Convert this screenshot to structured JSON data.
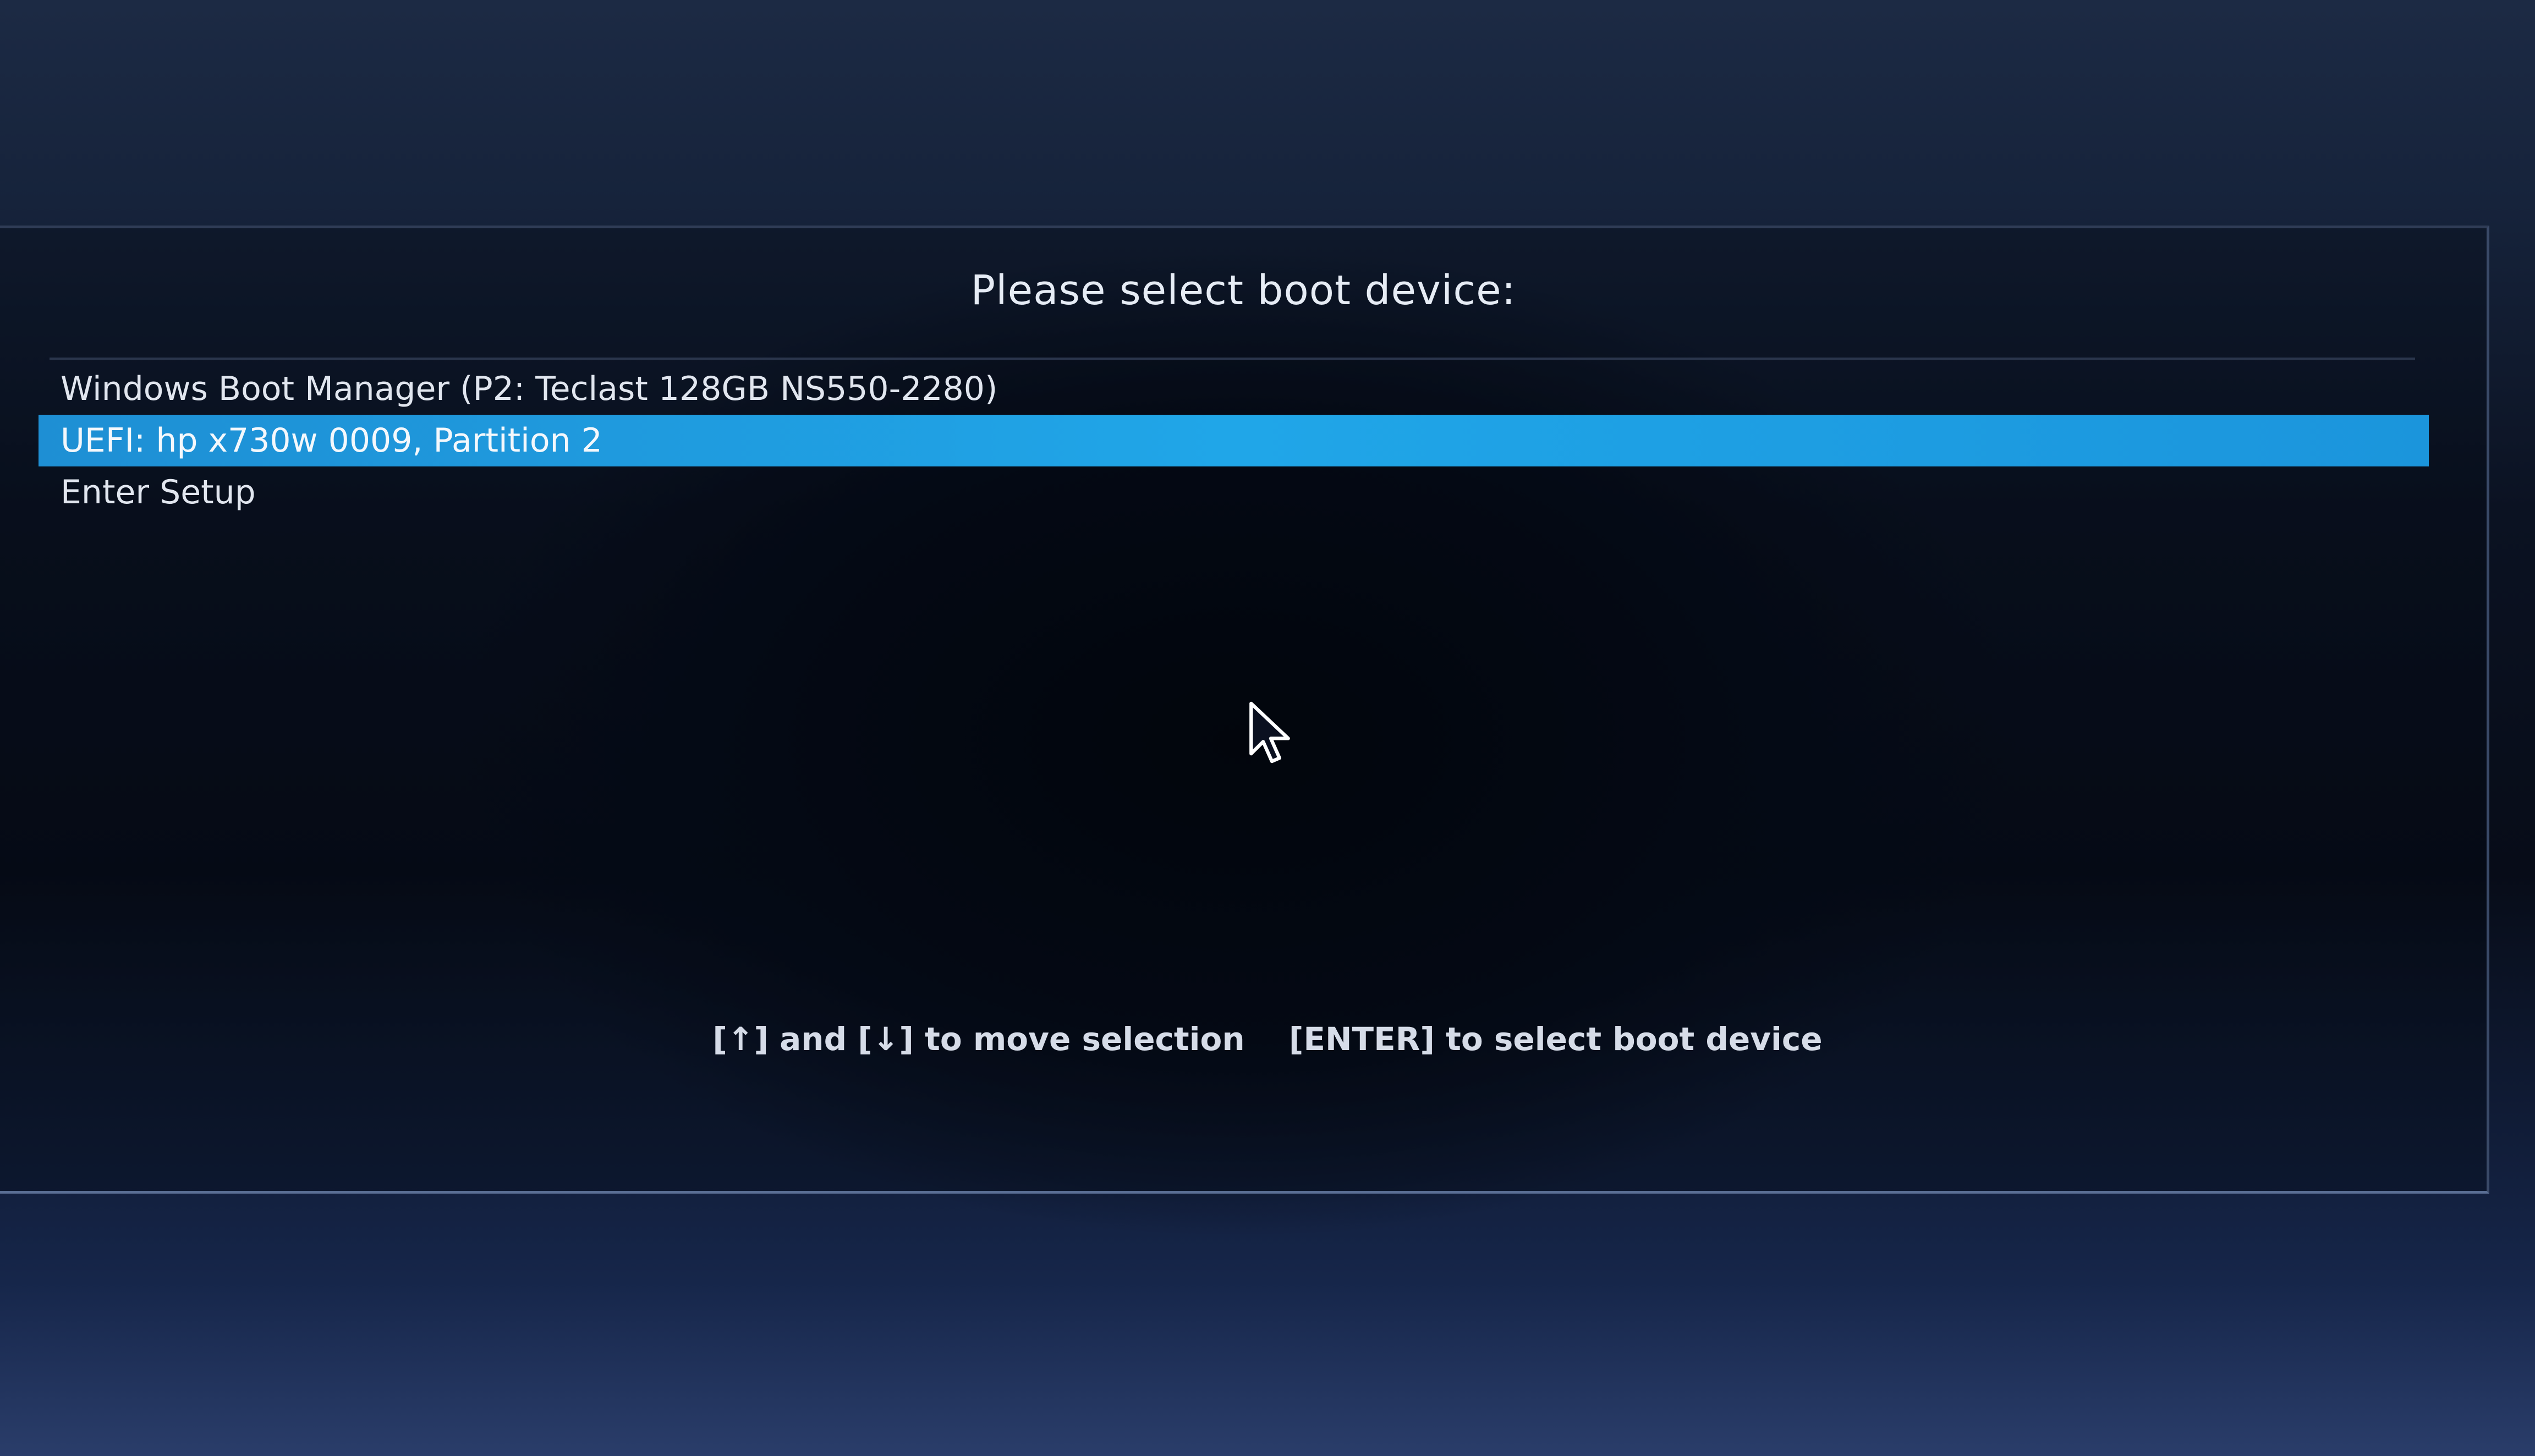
{
  "title": "Please select boot device:",
  "boot_devices": [
    {
      "label": "Windows Boot Manager (P2: Teclast 128GB NS550-2280)",
      "selected": false
    },
    {
      "label": "UEFI: hp x730w 0009, Partition 2",
      "selected": true
    },
    {
      "label": "Enter Setup",
      "selected": false
    }
  ],
  "hints": {
    "move": "[↑] and [↓] to move selection",
    "select": "[ENTER] to select boot device"
  },
  "colors": {
    "selection_highlight": "#20a6e8",
    "text": "#e1e6ef",
    "background": "#070c18"
  },
  "icons": {
    "cursor": "mouse-pointer-icon"
  }
}
